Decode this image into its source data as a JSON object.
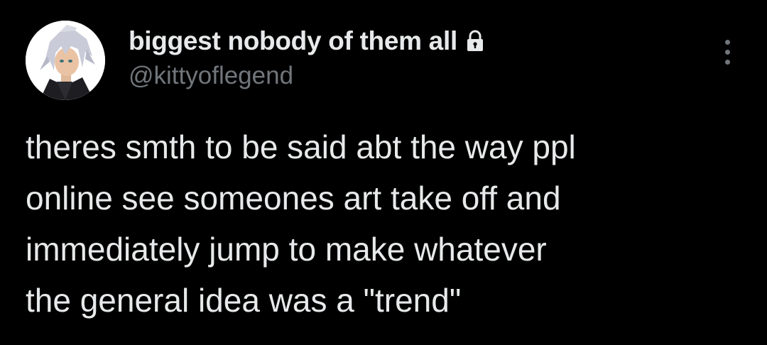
{
  "author": {
    "display_name": "biggest nobody of them all",
    "handle": "@kittyoflegend",
    "protected_icon": "lock-icon",
    "avatar_icon": "avatar-image"
  },
  "menu": {
    "more_icon": "more-vertical-icon"
  },
  "tweet": {
    "lines": [
      "theres smth to be said abt the way ppl",
      "online see someones art take off and",
      "immediately jump to make whatever",
      "the general idea was a \"trend\""
    ]
  },
  "colors": {
    "background": "#000000",
    "primary_text": "#e7e9ea",
    "secondary_text": "#71767b"
  }
}
